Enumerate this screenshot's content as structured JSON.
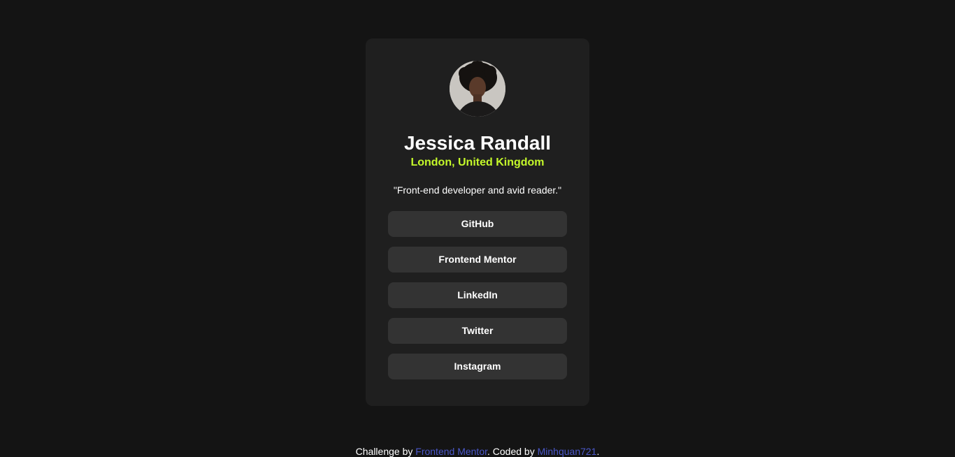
{
  "profile": {
    "name": "Jessica Randall",
    "location": "London, United Kingdom",
    "bio": "\"Front-end developer and avid reader.\"",
    "avatar_icon": "profile-photo"
  },
  "links": [
    {
      "label": "GitHub"
    },
    {
      "label": "Frontend Mentor"
    },
    {
      "label": "LinkedIn"
    },
    {
      "label": "Twitter"
    },
    {
      "label": "Instagram"
    }
  ],
  "footer": {
    "prefix": "Challenge by ",
    "challenge_link": "Frontend Mentor",
    "middle": ". Coded by ",
    "author_link": "Minhquan721",
    "suffix": "."
  },
  "colors": {
    "background": "#141414",
    "card": "#1f1f1f",
    "button": "#333333",
    "accent_green": "#c4f82a",
    "link_blue": "#4a57c9"
  }
}
